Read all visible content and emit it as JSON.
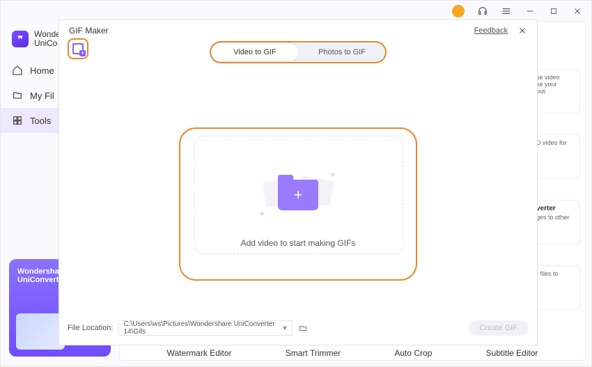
{
  "titlebar": {},
  "sidebar": {
    "brand1": "Wonde",
    "brand2": "UniCo",
    "items": [
      {
        "label": "Home"
      },
      {
        "label": "My Fil"
      },
      {
        "label": "Tools"
      }
    ]
  },
  "promo": {
    "line1": "Wondersha",
    "line2": "UniConvert"
  },
  "behind_cards": [
    {
      "title": "",
      "body": "se video\nke your\nout."
    },
    {
      "title": "",
      "body": "D video for"
    },
    {
      "title": "verter",
      "body": "ges to other"
    },
    {
      "title": "",
      "body": "r files to"
    }
  ],
  "bottom_tools": [
    "Watermark Editor",
    "Smart Trimmer",
    "Auto Crop",
    "Subtitle Editor"
  ],
  "modal": {
    "title": "GIF Maker",
    "feedback": "Feedback",
    "tabs": {
      "video": "Video to GIF",
      "photos": "Photos to GIF"
    },
    "drop_text": "Add video to start making GIFs",
    "file_location_label": "File Location:",
    "file_location_value": "C:\\Users\\ws\\Pictures\\Wondershare UniConverter 14\\Gifs",
    "create_label": "Create GIF"
  }
}
